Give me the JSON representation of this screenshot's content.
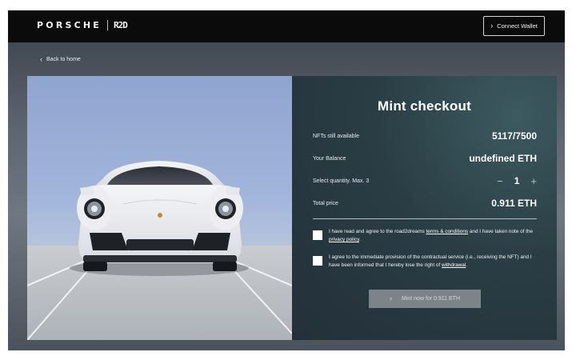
{
  "header": {
    "brand": "PORSCHE",
    "brand_mark": "R2D",
    "connect_wallet": "Connect Wallet"
  },
  "nav": {
    "back": "Back to home"
  },
  "checkout": {
    "title": "Mint checkout",
    "rows": [
      {
        "label": "NFTs still available",
        "value": "5117/7500"
      },
      {
        "label": "Your Balance",
        "value": "undefined ETH"
      },
      {
        "label": "Select quantity. Max. 3",
        "value": "1"
      },
      {
        "label": "Total price",
        "value": "0.911 ETH"
      }
    ],
    "qty_minus": "−",
    "qty_plus": "+",
    "consent1": {
      "prefix": "I have read and agree to the road2dreams ",
      "link1": "terms & conditions",
      "middle": " and I have taken note of the ",
      "link2": "privacy policy",
      "suffix": "."
    },
    "consent2": {
      "prefix": "I agree to the immediate provision of the contractual service (i.e., receiving the NFT) and I have been informed that I hereby lose the right of ",
      "link": "withdrawal",
      "suffix": "."
    },
    "mint_button": "Mint now for 0.911 ETH"
  },
  "colors": {
    "header_bg": "#0b0b0c",
    "panel_bg": "#2a3d44",
    "mint_button_bg": "#7c8489"
  }
}
